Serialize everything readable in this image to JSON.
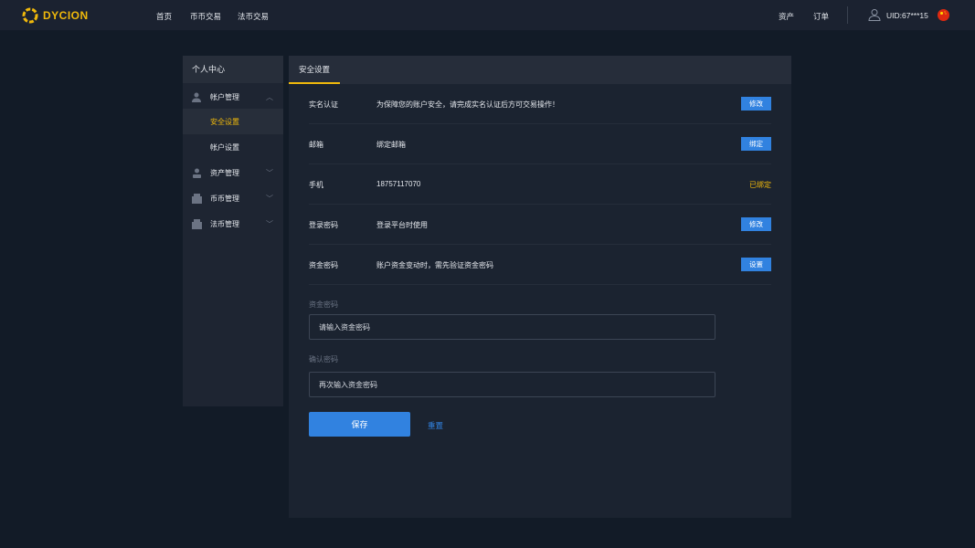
{
  "header": {
    "logo": "DYCION",
    "nav": [
      "首页",
      "币币交易",
      "法币交易"
    ],
    "right": [
      "资产",
      "订单"
    ],
    "uid": "UID:67***15"
  },
  "sidebar": {
    "title": "个人中心",
    "items": [
      {
        "label": "帐户管理",
        "icon": "user-icon",
        "chev": "︿"
      },
      {
        "label": "安全设置"
      },
      {
        "label": "帐户设置"
      },
      {
        "label": "资产管理",
        "icon": "asset-icon",
        "chev": "﹀"
      },
      {
        "label": "币币管理",
        "icon": "coin-icon",
        "chev": "﹀"
      },
      {
        "label": "法币管理",
        "icon": "fiat-icon",
        "chev": "﹀"
      }
    ]
  },
  "main": {
    "tab": "安全设置",
    "rows": [
      {
        "label": "实名认证",
        "desc": "为保障您的账户安全，请完成实名认证后方可交易操作！",
        "action": "修改"
      },
      {
        "label": "邮箱",
        "desc": "绑定邮箱",
        "action": "绑定"
      },
      {
        "label": "手机",
        "desc": "18757117070",
        "status": "已绑定"
      },
      {
        "label": "登录密码",
        "desc": "登录平台时使用",
        "action": "修改"
      },
      {
        "label": "资金密码",
        "desc": "账户资金变动时，需先验证资金密码",
        "action": "设置"
      }
    ],
    "form": {
      "fund_label": "资金密码",
      "fund_placeholder": "请输入资金密码",
      "confirm_label": "确认密码",
      "confirm_placeholder": "再次输入资金密码",
      "save": "保存",
      "reset": "重置"
    }
  },
  "colors": {
    "accent": "#f0b90b",
    "primary": "#3182e0"
  }
}
